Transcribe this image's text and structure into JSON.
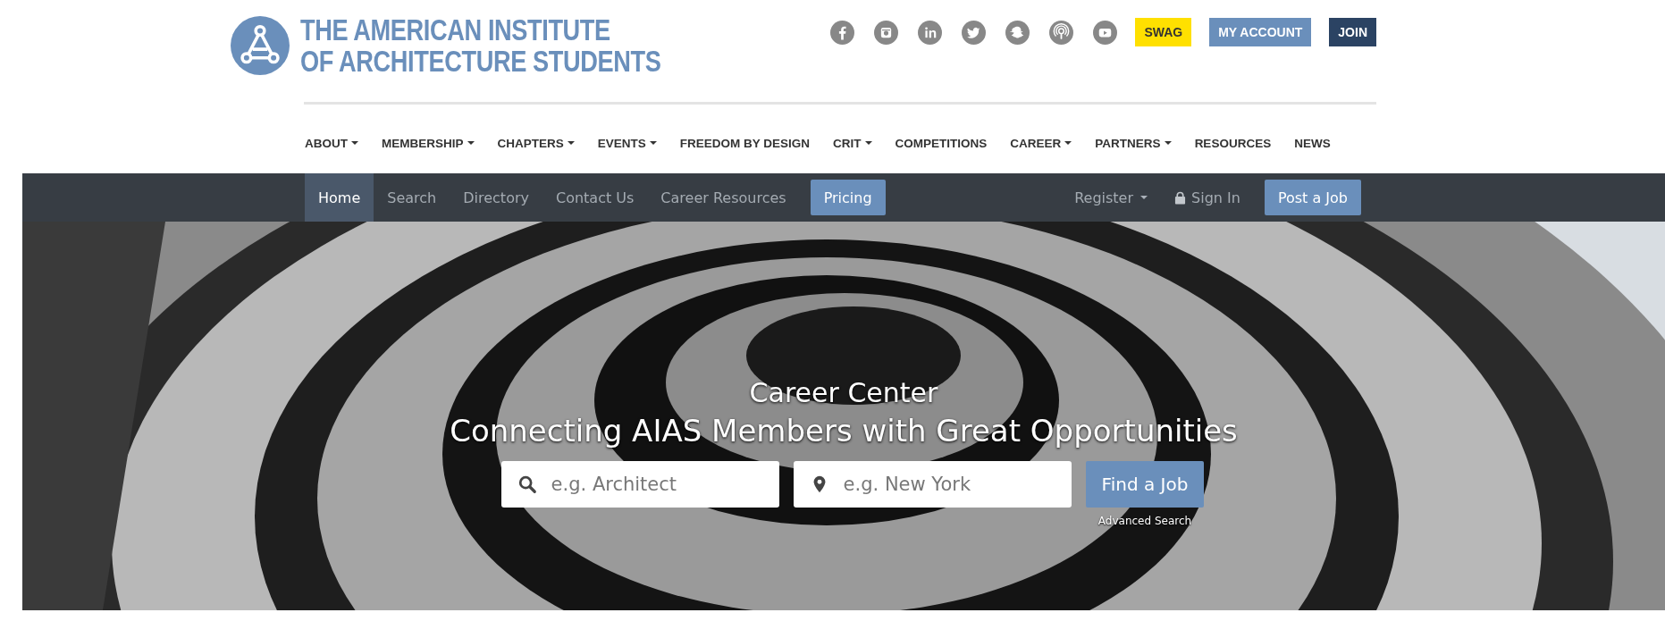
{
  "header": {
    "logo_line_1": "THE AMERICAN INSTITUTE",
    "logo_line_2": "OF ARCHITECTURE STUDENTS",
    "social_icons": [
      {
        "kind": "facebook"
      },
      {
        "kind": "instagram"
      },
      {
        "kind": "linkedin"
      },
      {
        "kind": "twitter"
      },
      {
        "kind": "snapchat"
      },
      {
        "kind": "podcast"
      },
      {
        "kind": "youtube"
      }
    ],
    "buttons": [
      {
        "label": "SWAG",
        "kind": "swag"
      },
      {
        "label": "MY ACCOUNT",
        "kind": "account"
      },
      {
        "label": "JOIN",
        "kind": "join"
      }
    ]
  },
  "main_nav": [
    {
      "label": "ABOUT",
      "dropdown": true
    },
    {
      "label": "MEMBERSHIP",
      "dropdown": true
    },
    {
      "label": "CHAPTERS",
      "dropdown": true
    },
    {
      "label": "EVENTS",
      "dropdown": true
    },
    {
      "label": "FREEDOM BY DESIGN",
      "dropdown": false
    },
    {
      "label": "CRIT",
      "dropdown": true
    },
    {
      "label": "COMPETITIONS",
      "dropdown": false
    },
    {
      "label": "CAREER",
      "dropdown": true
    },
    {
      "label": "PARTNERS",
      "dropdown": true
    },
    {
      "label": "RESOURCES",
      "dropdown": false
    },
    {
      "label": "NEWS",
      "dropdown": false
    }
  ],
  "career_nav": {
    "left": [
      {
        "label": "Home",
        "selected": true,
        "kind": "link"
      },
      {
        "label": "Search",
        "selected": false,
        "kind": "link"
      },
      {
        "label": "Directory",
        "selected": false,
        "kind": "link"
      },
      {
        "label": "Contact Us",
        "selected": false,
        "kind": "link"
      },
      {
        "label": "Career Resources",
        "selected": false,
        "kind": "link"
      },
      {
        "label": "Pricing",
        "selected": false,
        "kind": "button"
      }
    ],
    "right": [
      {
        "label": "Register",
        "kind": "dropdown"
      },
      {
        "label": "Sign In",
        "kind": "signin"
      },
      {
        "label": "Post a Job",
        "kind": "button"
      }
    ]
  },
  "hero": {
    "kind": "picture",
    "title": "Career Center",
    "subtitle": "Connecting AIAS Members with Great Opportunities",
    "keyword_field": {
      "placeholder": "e.g. Architect"
    },
    "location_field": {
      "placeholder": "e.g. New York"
    },
    "search_button": "Find a Job",
    "advanced_link": "Advanced Search"
  }
}
